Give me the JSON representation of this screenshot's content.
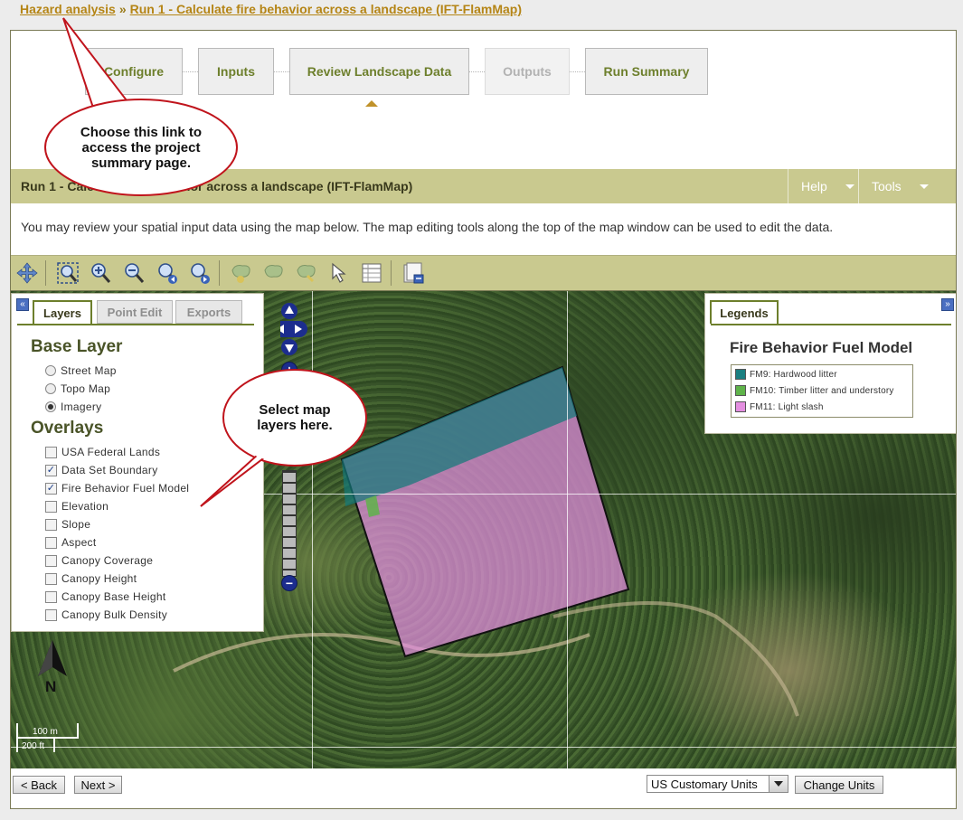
{
  "breadcrumb": {
    "items": [
      "Hazard analysis",
      "Run 1 - Calculate fire behavior across a landscape (IFT-FlamMap)"
    ],
    "separator": "»"
  },
  "steps": [
    {
      "label": "Configure",
      "state": "enabled"
    },
    {
      "label": "Inputs",
      "state": "enabled"
    },
    {
      "label": "Review Landscape Data",
      "state": "current"
    },
    {
      "label": "Outputs",
      "state": "disabled"
    },
    {
      "label": "Run Summary",
      "state": "enabled"
    }
  ],
  "run_title": "Run 1 - Calculate fire behavior across a landscape (IFT-FlamMap)",
  "menus": {
    "help": "Help",
    "tools": "Tools"
  },
  "intro_text": "You may review your spatial input data using the map below. The map editing tools along the top of the map window can be used to edit the data.",
  "toolbar_icons": [
    "pan-icon",
    "zoom-extent-icon",
    "zoom-in-icon",
    "zoom-out-icon",
    "zoom-previous-icon",
    "zoom-next-icon",
    "polygon-add-icon",
    "polygon-edit-icon",
    "polygon-delete-icon",
    "select-arrow-icon",
    "attribute-table-icon",
    "export-icon"
  ],
  "left_panel": {
    "tabs": [
      "Layers",
      "Point Edit",
      "Exports"
    ],
    "active_tab": "Layers",
    "base_layer_heading": "Base Layer",
    "base_layers": [
      {
        "label": "Street Map",
        "selected": false
      },
      {
        "label": "Topo Map",
        "selected": false
      },
      {
        "label": "Imagery",
        "selected": true
      }
    ],
    "overlays_heading": "Overlays",
    "overlays": [
      {
        "label": "USA Federal Lands",
        "checked": false
      },
      {
        "label": "Data Set Boundary",
        "checked": true
      },
      {
        "label": "Fire Behavior Fuel Model",
        "checked": true
      },
      {
        "label": "Elevation",
        "checked": false
      },
      {
        "label": "Slope",
        "checked": false
      },
      {
        "label": "Aspect",
        "checked": false
      },
      {
        "label": "Canopy Coverage",
        "checked": false
      },
      {
        "label": "Canopy Height",
        "checked": false
      },
      {
        "label": "Canopy Base Height",
        "checked": false
      },
      {
        "label": "Canopy Bulk Density",
        "checked": false
      }
    ],
    "collapse_glyph": "«"
  },
  "legend_panel": {
    "tab": "Legends",
    "title": "Fire Behavior Fuel Model",
    "items": [
      {
        "label": "FM9: Hardwood litter",
        "color": "#1a7f80"
      },
      {
        "label": "FM10: Timber litter and understory",
        "color": "#5fb34a"
      },
      {
        "label": "FM11: Light slash",
        "color": "#e48fe0"
      }
    ],
    "expand_glyph": "»"
  },
  "map": {
    "north_label": "N",
    "scale_metric": "100 m",
    "scale_imperial": "200 ft",
    "zoom_in": "+",
    "zoom_out": "−"
  },
  "footer": {
    "back": "< Back",
    "next": "Next >",
    "units_selected": "US Customary Units",
    "change_units": "Change Units"
  },
  "callouts": {
    "summary": "Choose this link to access the project summary page.",
    "layers": "Select map layers here."
  },
  "colors": {
    "accent": "#c9c98f",
    "link": "#b58516",
    "step_text": "#6d7f2c",
    "callout_border": "#c0141c"
  }
}
